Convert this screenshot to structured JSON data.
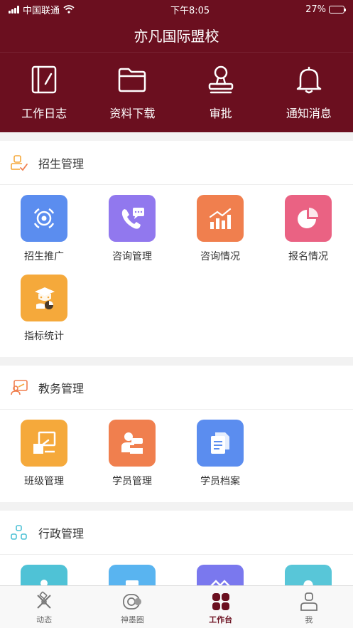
{
  "status": {
    "carrier": "中国联通",
    "time": "下午8:05",
    "battery": "27%",
    "battery_level": 0.27
  },
  "header": {
    "title": "亦凡国际盟校"
  },
  "quick": [
    {
      "label": "工作日志",
      "icon": "notebook-icon"
    },
    {
      "label": "资料下载",
      "icon": "folder-icon"
    },
    {
      "label": "审批",
      "icon": "stamp-icon"
    },
    {
      "label": "通知消息",
      "icon": "bell-icon"
    }
  ],
  "sections": [
    {
      "title": "招生管理",
      "icon": "enrollment-section-icon",
      "items": [
        {
          "label": "招生推广",
          "color": "#5b8def",
          "icon": "target-icon"
        },
        {
          "label": "咨询管理",
          "color": "#9178ee",
          "icon": "phone-chat-icon"
        },
        {
          "label": "咨询情况",
          "color": "#f07f4e",
          "icon": "bar-chart-icon"
        },
        {
          "label": "报名情况",
          "color": "#ea6283",
          "icon": "pie-chart-icon"
        },
        {
          "label": "指标统计",
          "color": "#f5a93b",
          "icon": "graduate-stats-icon"
        }
      ]
    },
    {
      "title": "教务管理",
      "icon": "academic-section-icon",
      "items": [
        {
          "label": "班级管理",
          "color": "#f5a93b",
          "icon": "classroom-icon"
        },
        {
          "label": "学员管理",
          "color": "#f07f4e",
          "icon": "student-icon"
        },
        {
          "label": "学员档案",
          "color": "#5b8def",
          "icon": "documents-icon"
        }
      ]
    },
    {
      "title": "行政管理",
      "icon": "admin-section-icon",
      "items": [
        {
          "label": "",
          "color": "#4fc2d6",
          "icon": "admin-item-1-icon"
        },
        {
          "label": "",
          "color": "#59b4f0",
          "icon": "admin-item-2-icon"
        },
        {
          "label": "",
          "color": "#7a78ee",
          "icon": "admin-item-3-icon"
        },
        {
          "label": "",
          "color": "#58c6d8",
          "icon": "admin-item-4-icon"
        }
      ]
    }
  ],
  "tabs": [
    {
      "label": "动态",
      "icon": "dynamics-icon"
    },
    {
      "label": "神墨圈",
      "icon": "circle-icon"
    },
    {
      "label": "工作台",
      "icon": "workbench-icon",
      "active": true
    },
    {
      "label": "我",
      "icon": "profile-icon"
    }
  ],
  "colors": {
    "brand": "#6b0f1f"
  }
}
